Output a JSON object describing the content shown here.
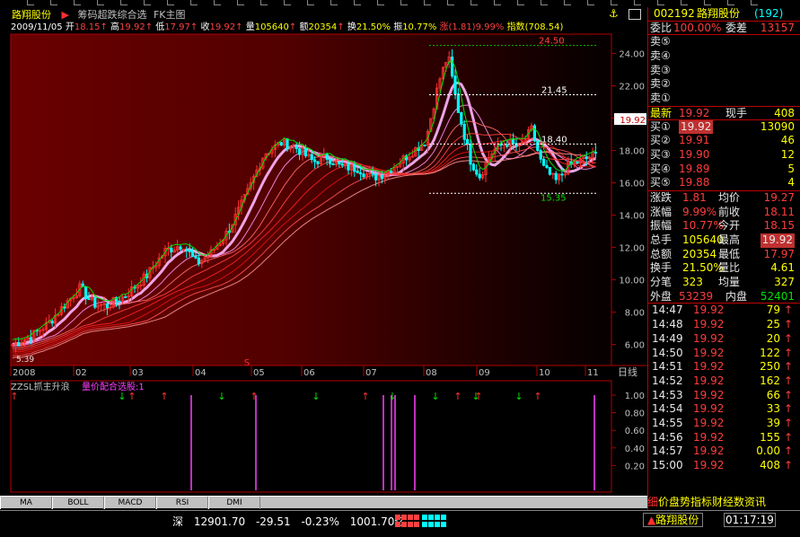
{
  "header": {
    "stock_name": "路翔股份",
    "arrow": "▶",
    "formula": "筹码超跌综合选",
    "chart_mode": "FK主图"
  },
  "info_bar": {
    "date": "2009/11/05",
    "open_label": "开",
    "open": "18.15",
    "high_label": "高",
    "high": "19.92",
    "low_label": "低",
    "low": "17.97",
    "close_label": "收",
    "close": "19.92",
    "vol_label": "量",
    "vol": "105640",
    "amt_label": "额",
    "amt": "20354",
    "turn_label": "换",
    "turn": "21.50%",
    "amp_label": "振",
    "amp": "10.77%",
    "chg_label": "涨",
    "chg": "(1.81)",
    "chg_pct": "9.99%",
    "index_label": "指数",
    "index": "(708.54)"
  },
  "price_axis": {
    "ticks": [
      "24.00",
      "22.00",
      "20.00",
      "18.00",
      "16.00",
      "14.00",
      "12.00",
      "10.00",
      "8.00",
      "6.00"
    ],
    "current_tag": "19.92"
  },
  "chart_labels": {
    "high_mark": "24.50",
    "level1": "21.45",
    "level2": "18.40",
    "level3": "15.35",
    "low_mark": "5.39",
    "s_marker": "S"
  },
  "date_axis": {
    "labels": [
      "2008",
      "02",
      "03",
      "04",
      "05",
      "06",
      "07",
      "08",
      "09",
      "10",
      "11"
    ],
    "period": "日线"
  },
  "indicator": {
    "name": "ZZSL抓主升浪",
    "title": "量价配合选股:1",
    "ticks": [
      "1.00",
      "0.80",
      "0.60",
      "0.40",
      "0.20"
    ]
  },
  "bottom_tabs": [
    "MA",
    "BOLL",
    "MACD",
    "RSI",
    "DMI"
  ],
  "quote_panel": {
    "code": "002192",
    "name": "路翔股份",
    "num": "(192)",
    "weibi_label": "委比",
    "weibi": "100.00%",
    "weicha_label": "委差",
    "weicha": "13157",
    "sell": [
      {
        "label": "卖⑤",
        "price": "",
        "vol": ""
      },
      {
        "label": "卖④",
        "price": "",
        "vol": ""
      },
      {
        "label": "卖③",
        "price": "",
        "vol": ""
      },
      {
        "label": "卖②",
        "price": "",
        "vol": ""
      },
      {
        "label": "卖①",
        "price": "",
        "vol": ""
      }
    ],
    "latest_label": "最新",
    "latest": "19.92",
    "shou_label": "现手",
    "shou": "408",
    "buy": [
      {
        "label": "买①",
        "price": "19.92",
        "vol": "13090"
      },
      {
        "label": "买②",
        "price": "19.91",
        "vol": "46"
      },
      {
        "label": "买③",
        "price": "19.90",
        "vol": "12"
      },
      {
        "label": "买④",
        "price": "19.89",
        "vol": "5"
      },
      {
        "label": "买⑤",
        "price": "19.88",
        "vol": "4"
      }
    ],
    "stats": [
      {
        "l": "涨跌",
        "v": "1.81",
        "l2": "均价",
        "v2": "19.27"
      },
      {
        "l": "涨幅",
        "v": "9.99%",
        "l2": "前收",
        "v2": "18.11"
      },
      {
        "l": "振幅",
        "v": "10.77%",
        "l2": "今开",
        "v2": "18.15"
      },
      {
        "l": "总手",
        "v": "105640",
        "l2": "最高",
        "v2": "19.92"
      },
      {
        "l": "总额",
        "v": "20354",
        "l2": "最低",
        "v2": "17.97"
      },
      {
        "l": "换手",
        "v": "21.50%",
        "l2": "量比",
        "v2": "4.61"
      },
      {
        "l": "分笔",
        "v": "323",
        "l2": "均量",
        "v2": "327"
      }
    ],
    "outer_label": "外盘",
    "outer": "53239",
    "inner_label": "内盘",
    "inner": "52401",
    "ticks": [
      {
        "t": "14:47",
        "p": "19.92",
        "v": "79"
      },
      {
        "t": "14:48",
        "p": "19.92",
        "v": "25"
      },
      {
        "t": "14:49",
        "p": "19.92",
        "v": "20"
      },
      {
        "t": "14:50",
        "p": "19.92",
        "v": "122"
      },
      {
        "t": "14:51",
        "p": "19.92",
        "v": "250"
      },
      {
        "t": "14:52",
        "p": "19.92",
        "v": "162"
      },
      {
        "t": "14:53",
        "p": "19.92",
        "v": "66"
      },
      {
        "t": "14:54",
        "p": "19.92",
        "v": "33"
      },
      {
        "t": "14:55",
        "p": "19.92",
        "v": "39"
      },
      {
        "t": "14:56",
        "p": "19.92",
        "v": "155"
      },
      {
        "t": "14:57",
        "p": "19.92",
        "v": "0.00"
      },
      {
        "t": "15:00",
        "p": "19.92",
        "v": "408"
      }
    ],
    "marquee_label": "细",
    "marquee_text": "价盘势指标财经数资讯"
  },
  "status_bar": {
    "index_name": "深",
    "index_value": "12901.70",
    "index_change": "-29.51",
    "index_pct": "-0.23%",
    "index_amount": "1001.70亿",
    "tab": "路翔股份",
    "clock": "01:17:19"
  },
  "colors": {
    "up": "#ff3c3c",
    "down": "#00e000",
    "accent": "#ffff00",
    "bg": "#000000"
  }
}
